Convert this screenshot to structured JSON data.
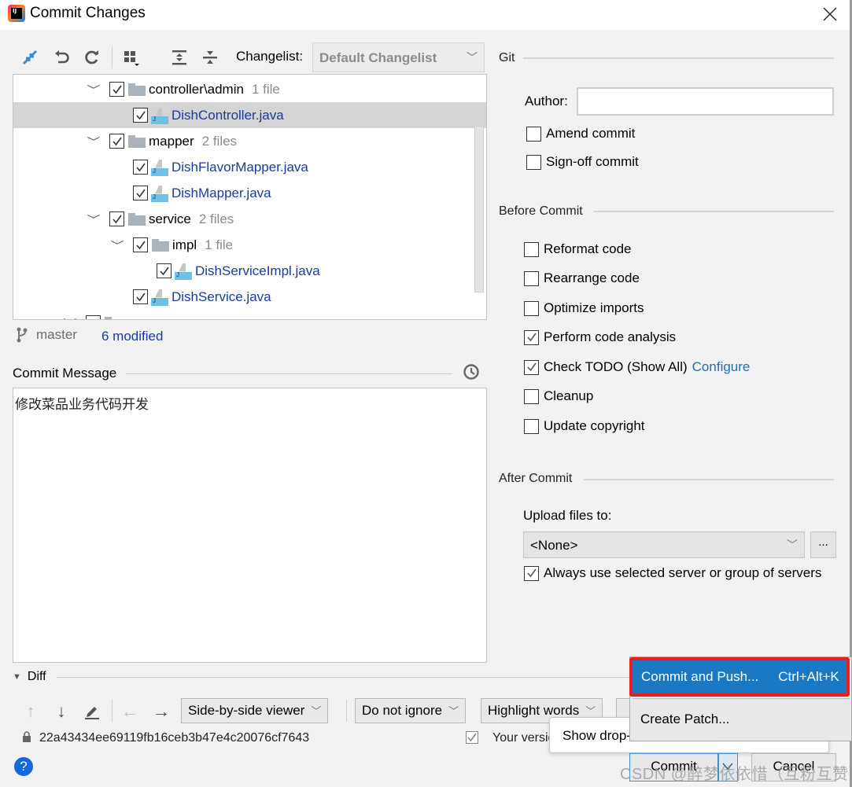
{
  "window": {
    "title": "Commit Changes",
    "close_label": "✕"
  },
  "toolbar": {
    "changelist_label": "Changelist:",
    "changelist_value": "Default Changelist"
  },
  "tree": {
    "rows": [
      {
        "type": "folder",
        "name": "controller\\admin",
        "count": "1 file",
        "checked": true,
        "expanded": true
      },
      {
        "type": "file",
        "name": "DishController.java",
        "checked": true,
        "selected": true
      },
      {
        "type": "folder",
        "name": "mapper",
        "count": "2 files",
        "checked": true,
        "expanded": true
      },
      {
        "type": "file",
        "name": "DishFlavorMapper.java",
        "checked": true
      },
      {
        "type": "file",
        "name": "DishMapper.java",
        "checked": true
      },
      {
        "type": "folder",
        "name": "service",
        "count": "2 files",
        "checked": true,
        "expanded": true
      },
      {
        "type": "folder",
        "name": "impl",
        "count": "1 file",
        "checked": true,
        "expanded": true
      },
      {
        "type": "file",
        "name": "DishServiceImpl.java",
        "checked": true
      },
      {
        "type": "file",
        "name": "DishService.java",
        "checked": true
      }
    ]
  },
  "status": {
    "branch": "master",
    "modified": "6 modified"
  },
  "commit_message": {
    "label": "Commit Message",
    "value": "修改菜品业务代码开发"
  },
  "git": {
    "section_title": "Git",
    "author_label": "Author:",
    "author_value": "",
    "options": [
      {
        "label": "Amend commit",
        "checked": false
      },
      {
        "label": "Sign-off commit",
        "checked": false
      }
    ]
  },
  "before_commit": {
    "section_title": "Before Commit",
    "options": [
      {
        "label": "Reformat code",
        "checked": false
      },
      {
        "label": "Rearrange code",
        "checked": false
      },
      {
        "label": "Optimize imports",
        "checked": false
      },
      {
        "label": "Perform code analysis",
        "checked": true
      },
      {
        "label": "Check TODO (Show All)",
        "checked": true,
        "link": "Configure"
      },
      {
        "label": "Cleanup",
        "checked": false
      },
      {
        "label": "Update copyright",
        "checked": false
      }
    ]
  },
  "after_commit": {
    "section_title": "After Commit",
    "upload_label": "Upload files to:",
    "upload_value": "<None>",
    "browse_label": "...",
    "always_use_label": "Always use selected server or group of servers",
    "always_use_checked": true
  },
  "diff": {
    "title": "Diff",
    "viewer": "Side-by-side viewer",
    "ignore": "Do not ignore",
    "highlight": "Highlight words",
    "hash": "22a43434ee69119fb16ceb3b47e4c20076cf7643",
    "your_version": "Your version"
  },
  "tooltip": {
    "text": "Show drop-down menu"
  },
  "buttons": {
    "commit": "Commit",
    "cancel": "Cancel",
    "help": "?"
  },
  "popup_menu": {
    "items": [
      {
        "label": "Commit and Push...",
        "shortcut": "Ctrl+Alt+K",
        "highlighted": true
      },
      {
        "label": "Create Patch..."
      }
    ]
  },
  "watermark": "CSDN @醉梦依依惜（互粉互赞）",
  "colors": {
    "accent": "#1b79c4",
    "link": "#1a3b9c",
    "highlight_border": "#ee1c1c"
  }
}
